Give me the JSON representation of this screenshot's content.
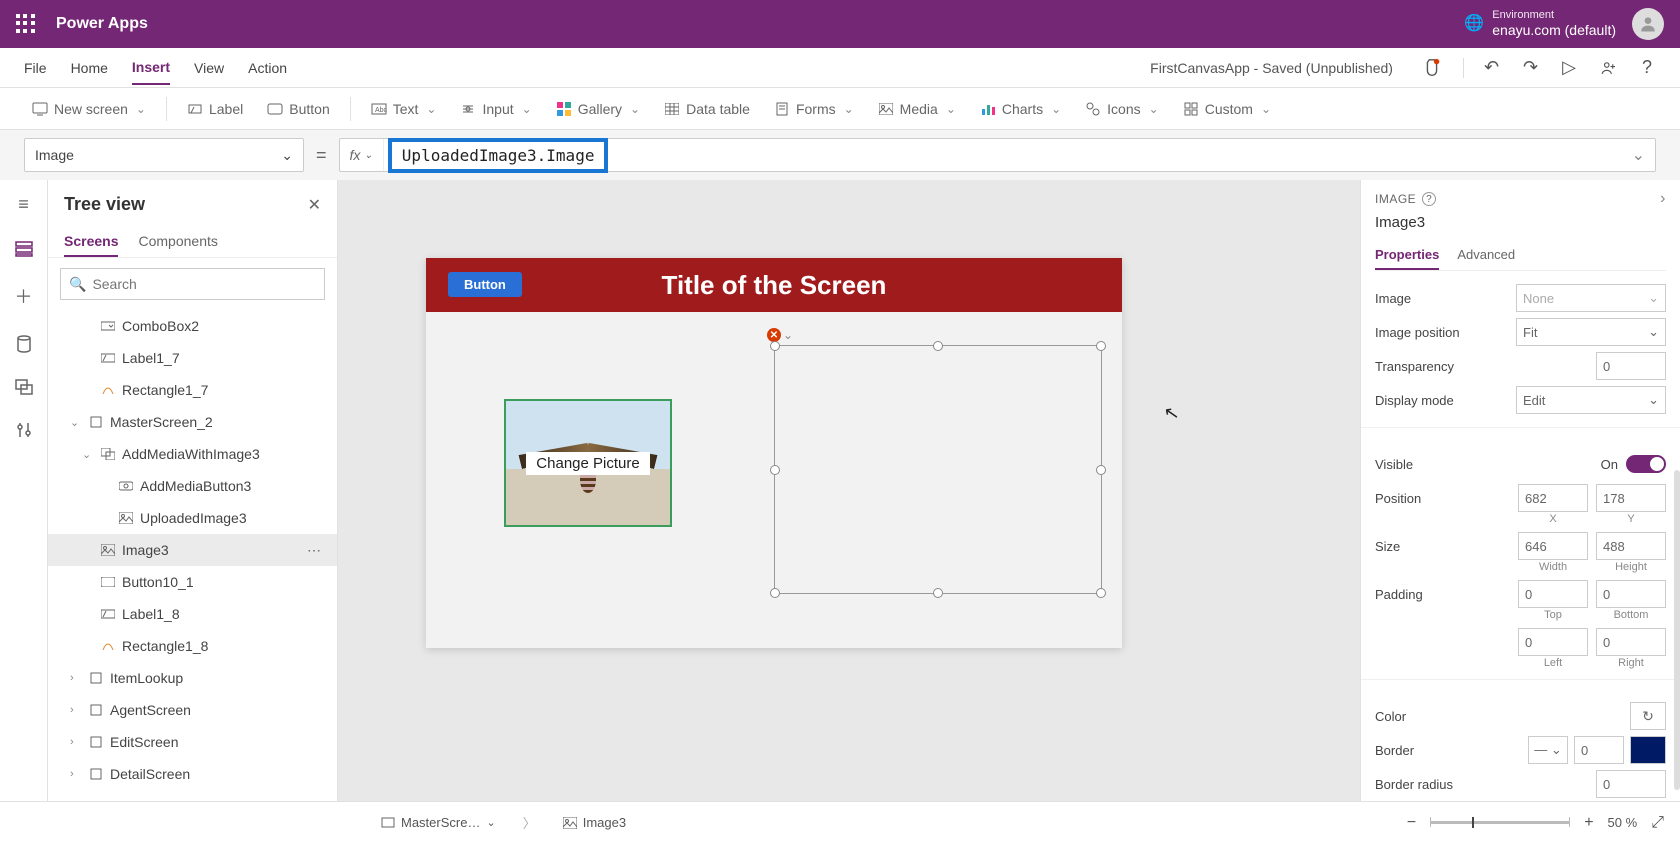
{
  "header": {
    "app_title": "Power Apps",
    "env_label": "Environment",
    "env_name": "enayu.com (default)"
  },
  "menu": {
    "items": [
      "File",
      "Home",
      "Insert",
      "View",
      "Action"
    ],
    "active": "Insert",
    "doc_title": "FirstCanvasApp - Saved (Unpublished)"
  },
  "ribbon": {
    "new_screen": "New screen",
    "label": "Label",
    "button": "Button",
    "text": "Text",
    "input": "Input",
    "gallery": "Gallery",
    "data_table": "Data table",
    "forms": "Forms",
    "media": "Media",
    "charts": "Charts",
    "icons": "Icons",
    "custom": "Custom"
  },
  "formula": {
    "property": "Image",
    "expression": "UploadedImage3.Image"
  },
  "tree": {
    "title": "Tree view",
    "tabs": {
      "screens": "Screens",
      "components": "Components"
    },
    "search_placeholder": "Search",
    "items": [
      {
        "label": "ComboBox2",
        "indent": 1,
        "icon": "combobox"
      },
      {
        "label": "Label1_7",
        "indent": 1,
        "icon": "label"
      },
      {
        "label": "Rectangle1_7",
        "indent": 1,
        "icon": "rect"
      },
      {
        "label": "MasterScreen_2",
        "indent": 0,
        "icon": "screen",
        "chev": "v"
      },
      {
        "label": "AddMediaWithImage3",
        "indent": 1,
        "icon": "group",
        "chev": "v"
      },
      {
        "label": "AddMediaButton3",
        "indent": 2,
        "icon": "mediabtn"
      },
      {
        "label": "UploadedImage3",
        "indent": 2,
        "icon": "image"
      },
      {
        "label": "Image3",
        "indent": 1,
        "icon": "image",
        "selected": true
      },
      {
        "label": "Button10_1",
        "indent": 1,
        "icon": "button"
      },
      {
        "label": "Label1_8",
        "indent": 1,
        "icon": "label"
      },
      {
        "label": "Rectangle1_8",
        "indent": 1,
        "icon": "rect"
      },
      {
        "label": "ItemLookup",
        "indent": 0,
        "icon": "screen",
        "chev": ">"
      },
      {
        "label": "AgentScreen",
        "indent": 0,
        "icon": "screen",
        "chev": ">"
      },
      {
        "label": "EditScreen",
        "indent": 0,
        "icon": "screen",
        "chev": ">"
      },
      {
        "label": "DetailScreen",
        "indent": 0,
        "icon": "screen",
        "chev": ">"
      }
    ]
  },
  "canvas": {
    "title": "Title of the Screen",
    "button_label": "Button",
    "change_picture": "Change Picture"
  },
  "props": {
    "heading": "IMAGE",
    "name": "Image3",
    "tabs": {
      "properties": "Properties",
      "advanced": "Advanced"
    },
    "image_label": "Image",
    "image_value": "None",
    "image_position_label": "Image position",
    "image_position_value": "Fit",
    "transparency_label": "Transparency",
    "transparency_value": "0",
    "display_mode_label": "Display mode",
    "display_mode_value": "Edit",
    "visible_label": "Visible",
    "visible_value": "On",
    "position_label": "Position",
    "pos_x": "682",
    "pos_y": "178",
    "pos_x_label": "X",
    "pos_y_label": "Y",
    "size_label": "Size",
    "size_w": "646",
    "size_h": "488",
    "size_w_label": "Width",
    "size_h_label": "Height",
    "padding_label": "Padding",
    "pad_t": "0",
    "pad_b": "0",
    "pad_l": "0",
    "pad_r": "0",
    "pad_t_label": "Top",
    "pad_b_label": "Bottom",
    "pad_l_label": "Left",
    "pad_r_label": "Right",
    "color_label": "Color",
    "border_label": "Border",
    "border_value": "0",
    "border_radius_label": "Border radius",
    "border_radius_value": "0"
  },
  "status": {
    "bc1": "MasterScre…",
    "bc2": "Image3",
    "zoom": "50",
    "zoom_pct": "%"
  }
}
